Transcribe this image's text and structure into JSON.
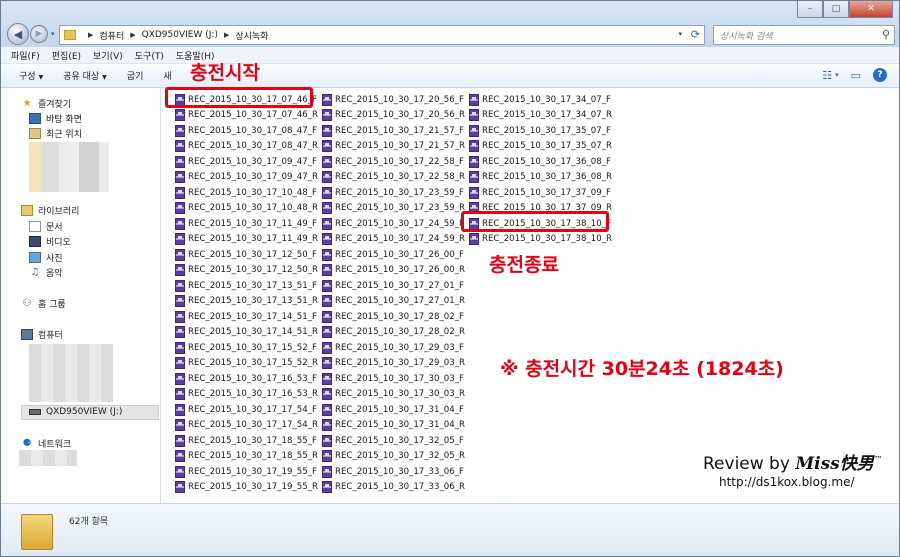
{
  "window": {
    "controls": {
      "min": "–",
      "max": "□",
      "close": "✕"
    }
  },
  "nav": {
    "back": "◀",
    "forward": "▶",
    "dropdown": "▾"
  },
  "address": {
    "crumbs": [
      "컴퓨터",
      "QXD950VIEW (J:)",
      "상시녹화"
    ],
    "separator": "▶"
  },
  "search": {
    "placeholder": "상시녹화 검색"
  },
  "menu": [
    "파일(F)",
    "편집(E)",
    "보기(V)",
    "도구(T)",
    "도움말(H)"
  ],
  "commands": [
    {
      "label": "구성",
      "dropdown": true
    },
    {
      "label": "공유 대상",
      "dropdown": true
    },
    {
      "label": "굽기",
      "dropdown": false
    },
    {
      "label": "새",
      "dropdown": false
    }
  ],
  "view_icons": [
    "view-options-icon",
    "preview-pane-icon",
    "help-icon"
  ],
  "sidebar": {
    "favorites": {
      "label": "즐겨찾기",
      "icon": "star-icon",
      "items": [
        {
          "label": "바탕 화면",
          "icon": "desktop-icon"
        },
        {
          "label": "최근 위치",
          "icon": "recent-places-icon"
        }
      ]
    },
    "libraries": {
      "label": "라이브러리",
      "icon": "library-icon",
      "items": [
        {
          "label": "문서",
          "icon": "document-icon"
        },
        {
          "label": "비디오",
          "icon": "video-icon"
        },
        {
          "label": "사진",
          "icon": "picture-icon"
        },
        {
          "label": "음악",
          "icon": "music-icon"
        }
      ]
    },
    "homegroup": {
      "label": "홈 그룹",
      "icon": "homegroup-icon"
    },
    "computer": {
      "label": "컴퓨터",
      "icon": "computer-icon",
      "drive": "QXD950VIEW (J:)"
    },
    "network": {
      "label": "네트워크",
      "icon": "network-icon"
    }
  },
  "files": {
    "columns": [
      [
        "REC_2015_10_30_17_07_46_F",
        "REC_2015_10_30_17_07_46_R",
        "REC_2015_10_30_17_08_47_F",
        "REC_2015_10_30_17_08_47_R",
        "REC_2015_10_30_17_09_47_F",
        "REC_2015_10_30_17_09_47_R",
        "REC_2015_10_30_17_10_48_F",
        "REC_2015_10_30_17_10_48_R",
        "REC_2015_10_30_17_11_49_F",
        "REC_2015_10_30_17_11_49_R",
        "REC_2015_10_30_17_12_50_F",
        "REC_2015_10_30_17_12_50_R",
        "REC_2015_10_30_17_13_51_F",
        "REC_2015_10_30_17_13_51_R",
        "REC_2015_10_30_17_14_51_F",
        "REC_2015_10_30_17_14_51_R",
        "REC_2015_10_30_17_15_52_F",
        "REC_2015_10_30_17_15_52_R",
        "REC_2015_10_30_17_16_53_F",
        "REC_2015_10_30_17_16_53_R",
        "REC_2015_10_30_17_17_54_F",
        "REC_2015_10_30_17_17_54_R",
        "REC_2015_10_30_17_18_55_F",
        "REC_2015_10_30_17_18_55_R",
        "REC_2015_10_30_17_19_55_F",
        "REC_2015_10_30_17_19_55_R"
      ],
      [
        "REC_2015_10_30_17_20_56_F",
        "REC_2015_10_30_17_20_56_R",
        "REC_2015_10_30_17_21_57_F",
        "REC_2015_10_30_17_21_57_R",
        "REC_2015_10_30_17_22_58_F",
        "REC_2015_10_30_17_22_58_R",
        "REC_2015_10_30_17_23_59_F",
        "REC_2015_10_30_17_23_59_R",
        "REC_2015_10_30_17_24_59_F",
        "REC_2015_10_30_17_24_59_R",
        "REC_2015_10_30_17_26_00_F",
        "REC_2015_10_30_17_26_00_R",
        "REC_2015_10_30_17_27_01_F",
        "REC_2015_10_30_17_27_01_R",
        "REC_2015_10_30_17_28_02_F",
        "REC_2015_10_30_17_28_02_R",
        "REC_2015_10_30_17_29_03_F",
        "REC_2015_10_30_17_29_03_R",
        "REC_2015_10_30_17_30_03_F",
        "REC_2015_10_30_17_30_03_R",
        "REC_2015_10_30_17_31_04_F",
        "REC_2015_10_30_17_31_04_R",
        "REC_2015_10_30_17_32_05_F",
        "REC_2015_10_30_17_32_05_R",
        "REC_2015_10_30_17_33_06_F",
        "REC_2015_10_30_17_33_06_R"
      ],
      [
        "REC_2015_10_30_17_34_07_F",
        "REC_2015_10_30_17_34_07_R",
        "REC_2015_10_30_17_35_07_F",
        "REC_2015_10_30_17_35_07_R",
        "REC_2015_10_30_17_36_08_F",
        "REC_2015_10_30_17_36_08_R",
        "REC_2015_10_30_17_37_09_F",
        "REC_2015_10_30_17_37_09_R",
        "REC_2015_10_30_17_38_10_F",
        "REC_2015_10_30_17_38_10_R"
      ]
    ]
  },
  "annotations": {
    "start": "충전시작",
    "end": "충전종료",
    "note": "※ 충전시간 30분24초 (1824초)",
    "accent": "#e60012"
  },
  "watermark": {
    "review": "Review by",
    "brand": "Miss快男",
    "tm": "™",
    "url": "http://ds1kox.blog.me/"
  },
  "status": {
    "count": "62개 항목"
  }
}
